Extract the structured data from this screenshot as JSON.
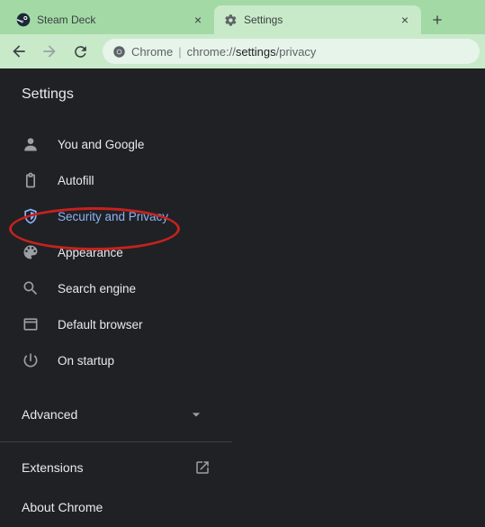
{
  "tabs": [
    {
      "title": "Steam Deck",
      "icon": "steam"
    },
    {
      "title": "Settings",
      "icon": "gear"
    }
  ],
  "address": {
    "scheme": "Chrome",
    "url_dim1": "chrome://",
    "url_strong": "settings",
    "url_dim2": "/privacy"
  },
  "page": {
    "title": "Settings"
  },
  "nav": [
    {
      "label": "You and Google",
      "icon": "person"
    },
    {
      "label": "Autofill",
      "icon": "clipboard"
    },
    {
      "label": "Security and Privacy",
      "icon": "shield"
    },
    {
      "label": "Appearance",
      "icon": "palette"
    },
    {
      "label": "Search engine",
      "icon": "search"
    },
    {
      "label": "Default browser",
      "icon": "window"
    },
    {
      "label": "On startup",
      "icon": "power"
    }
  ],
  "advanced": {
    "label": "Advanced"
  },
  "extensions": {
    "label": "Extensions"
  },
  "about": {
    "label": "About Chrome"
  }
}
